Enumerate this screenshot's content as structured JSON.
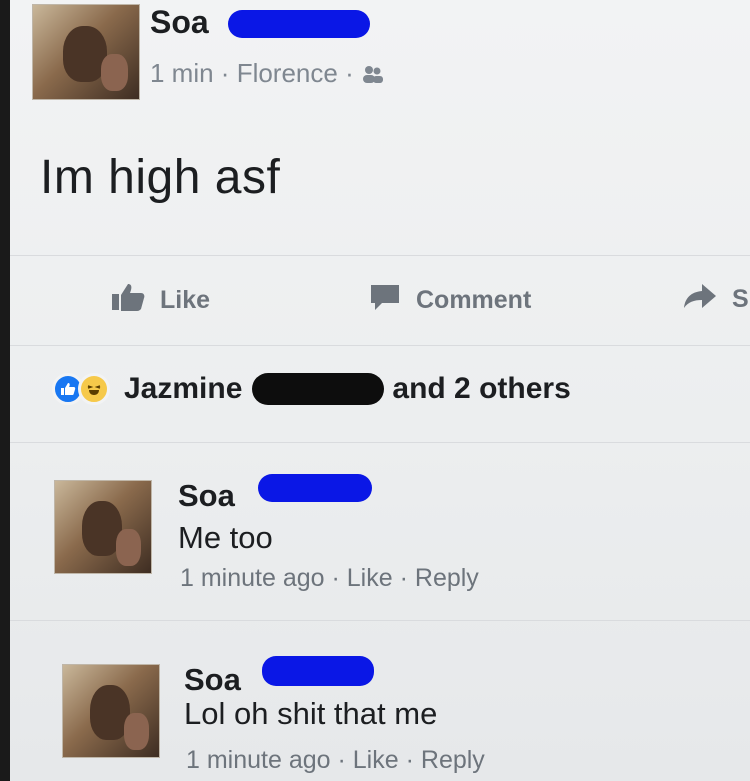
{
  "post": {
    "author": "Soa",
    "time": "1 min",
    "location": "Florence",
    "meta_sep": " · ",
    "text": "Im high asf",
    "audience_icon": "friends-icon"
  },
  "actions": {
    "like": "Like",
    "comment": "Comment",
    "share": "Sl"
  },
  "reactions": {
    "first_name": "Jazmine",
    "rest": "and 2 others",
    "icons": [
      "like-icon",
      "haha-icon"
    ]
  },
  "comments": [
    {
      "author": "Soa",
      "text": "Me too",
      "time": "1 minute ago",
      "like": "Like",
      "reply": "Reply"
    },
    {
      "author": "Soa",
      "text": "Lol oh shit that me",
      "time": "1 minute ago",
      "like": "Like",
      "reply": "Reply"
    }
  ],
  "colors": {
    "redaction_blue": "#0a17e6",
    "facebook_blue": "#1877f2"
  }
}
